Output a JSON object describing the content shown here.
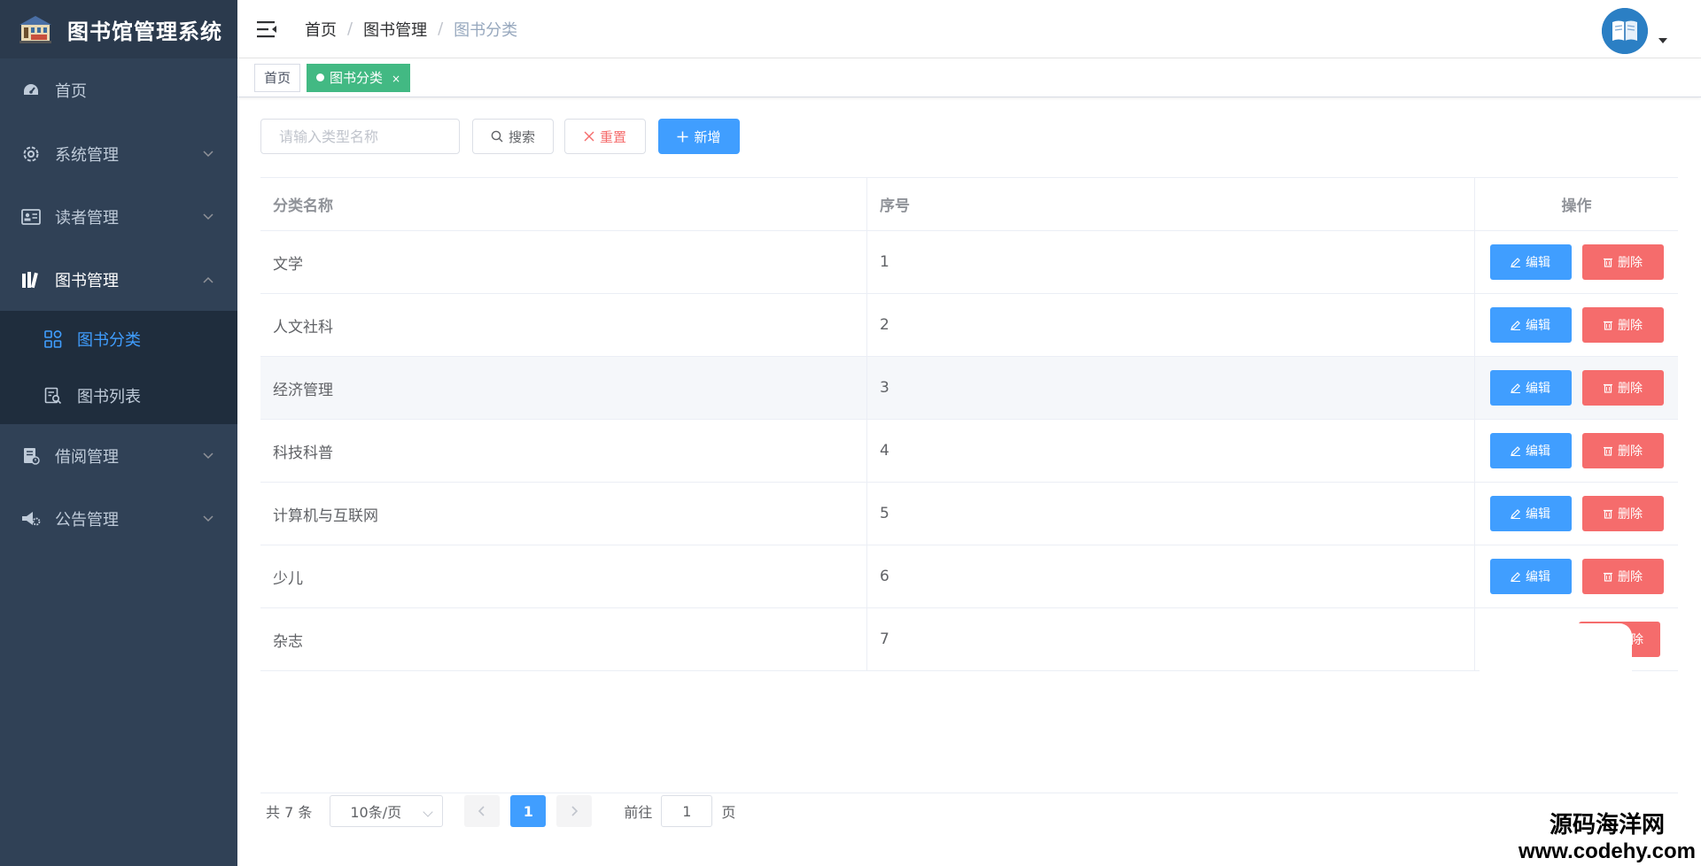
{
  "app": {
    "title": "图书馆管理系统"
  },
  "sidebar": {
    "items": [
      {
        "label": "首页"
      },
      {
        "label": "系统管理"
      },
      {
        "label": "读者管理"
      },
      {
        "label": "图书管理"
      },
      {
        "label": "借阅管理"
      },
      {
        "label": "公告管理"
      }
    ],
    "book_sub": [
      {
        "label": "图书分类"
      },
      {
        "label": "图书列表"
      }
    ]
  },
  "breadcrumb": [
    "首页",
    "图书管理",
    "图书分类"
  ],
  "tags": [
    {
      "label": "首页"
    },
    {
      "label": "图书分类",
      "close": "×"
    }
  ],
  "toolbar": {
    "search_placeholder": "请输入类型名称",
    "search_label": "搜索",
    "reset_label": "重置",
    "add_label": "新增"
  },
  "table": {
    "headers": [
      "分类名称",
      "序号",
      "操作"
    ],
    "rows": [
      {
        "name": "文学",
        "seq": "1"
      },
      {
        "name": "人文社科",
        "seq": "2"
      },
      {
        "name": "经济管理",
        "seq": "3"
      },
      {
        "name": "科技科普",
        "seq": "4"
      },
      {
        "name": "计算机与互联网",
        "seq": "5"
      },
      {
        "name": "少儿",
        "seq": "6"
      },
      {
        "name": "杂志",
        "seq": "7"
      }
    ],
    "edit_label": "编辑",
    "delete_label": "删除",
    "delete_partial": "除"
  },
  "pagination": {
    "total": "共 7 条",
    "page_size": "10条/页",
    "current": "1",
    "jump_prefix": "前往",
    "jump_value": "1",
    "jump_suffix": "页"
  },
  "watermark": {
    "cn": "源码海洋网",
    "en": "www.codehy.com"
  },
  "colors": {
    "sidebar_bg": "#304156",
    "primary": "#409eff",
    "danger": "#f56c6c",
    "tag_active": "#42b983"
  }
}
